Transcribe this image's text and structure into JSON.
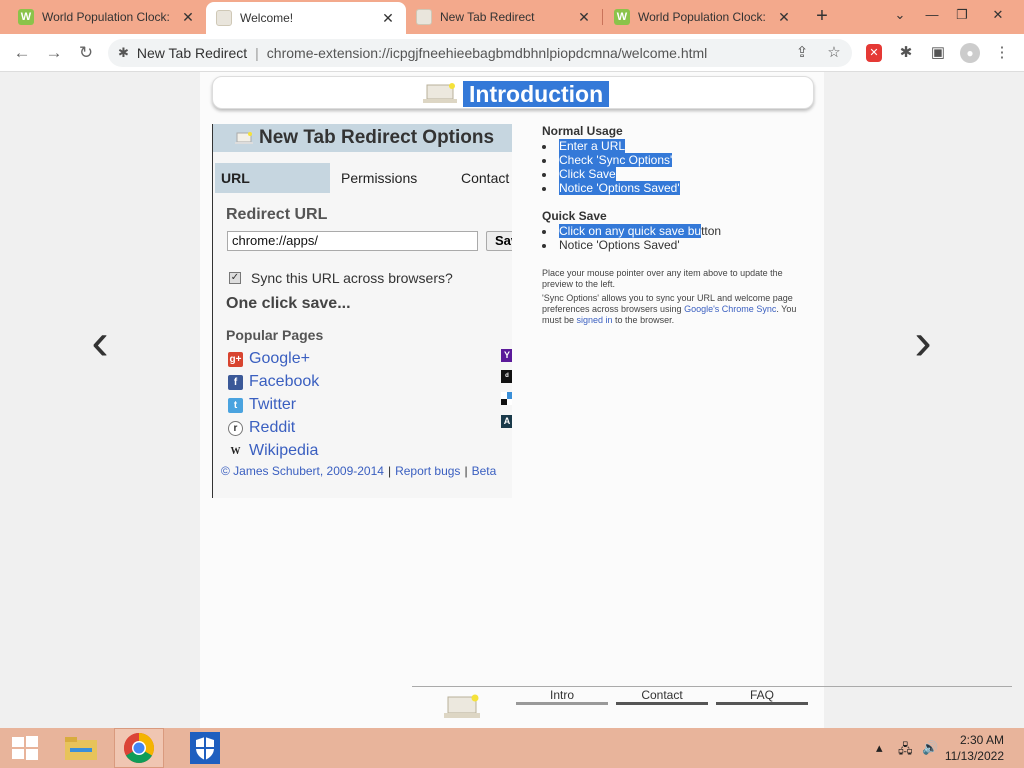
{
  "browser": {
    "tabs": [
      {
        "title": "World Population Clock:",
        "icon": "w-icon",
        "active": false
      },
      {
        "title": "Welcome!",
        "icon": "laptop-icon",
        "active": true
      },
      {
        "title": "New Tab Redirect",
        "icon": "laptop-icon",
        "active": false
      },
      {
        "title": "World Population Clock:",
        "icon": "w-icon",
        "active": false
      }
    ],
    "favicon_letter": "W",
    "new_tab": "+",
    "address": {
      "site_name": "New Tab Redirect",
      "url": "chrome-extension://icpgjfneehieebagbmdbhnlpiopdcmna/welcome.html"
    }
  },
  "intro": {
    "title": "Introduction"
  },
  "options": {
    "header": "New Tab Redirect Options",
    "tabs": [
      "URL",
      "Permissions",
      "Contact"
    ],
    "redirect_label": "Redirect URL",
    "url_value": "chrome://apps/",
    "save_label": "Save",
    "sync_label": "Sync this URL across browsers?",
    "sync_checked": true,
    "one_click": "One click save...",
    "popular_label": "Popular Pages",
    "popular_pages": [
      {
        "name": "Google+",
        "icon": "google-plus-icon",
        "glyph": "g+"
      },
      {
        "name": "Facebook",
        "icon": "facebook-icon",
        "glyph": "f"
      },
      {
        "name": "Twitter",
        "icon": "twitter-icon",
        "glyph": "t"
      },
      {
        "name": "Reddit",
        "icon": "reddit-icon",
        "glyph": "r"
      },
      {
        "name": "Wikipedia",
        "icon": "wikipedia-icon",
        "glyph": "W"
      }
    ],
    "footer": {
      "copyright": "© James Schubert, 2009-2014",
      "report": "Report bugs",
      "beta": "Beta",
      "separator": "|"
    }
  },
  "info": {
    "normal_usage_title": "Normal Usage",
    "normal_usage": [
      "Enter a URL",
      "Check 'Sync Options'",
      "Click Save",
      "Notice 'Options Saved'"
    ],
    "quick_save_title": "Quick Save",
    "quick_save_1_hl": "Click on any quick save bu",
    "quick_save_1_rest": "tton",
    "quick_save_2": "Notice 'Options Saved'",
    "note1": "Place your mouse pointer over any item above to update the preview to the left.",
    "note2_a": "'Sync Options' allows you to sync your URL and welcome page preferences across browsers using ",
    "note2_link": "Google's Chrome Sync",
    "note2_b": ". You must be ",
    "note2_link2": "signed in",
    "note2_c": " to the browser."
  },
  "bottom_nav": [
    "Intro",
    "Contact",
    "FAQ"
  ],
  "taskbar": {
    "time": "2:30 AM",
    "date": "11/13/2022"
  },
  "colors": {
    "tabstrip": "#f3a98c",
    "highlight": "#3479d8",
    "link": "#3a5fc0"
  }
}
